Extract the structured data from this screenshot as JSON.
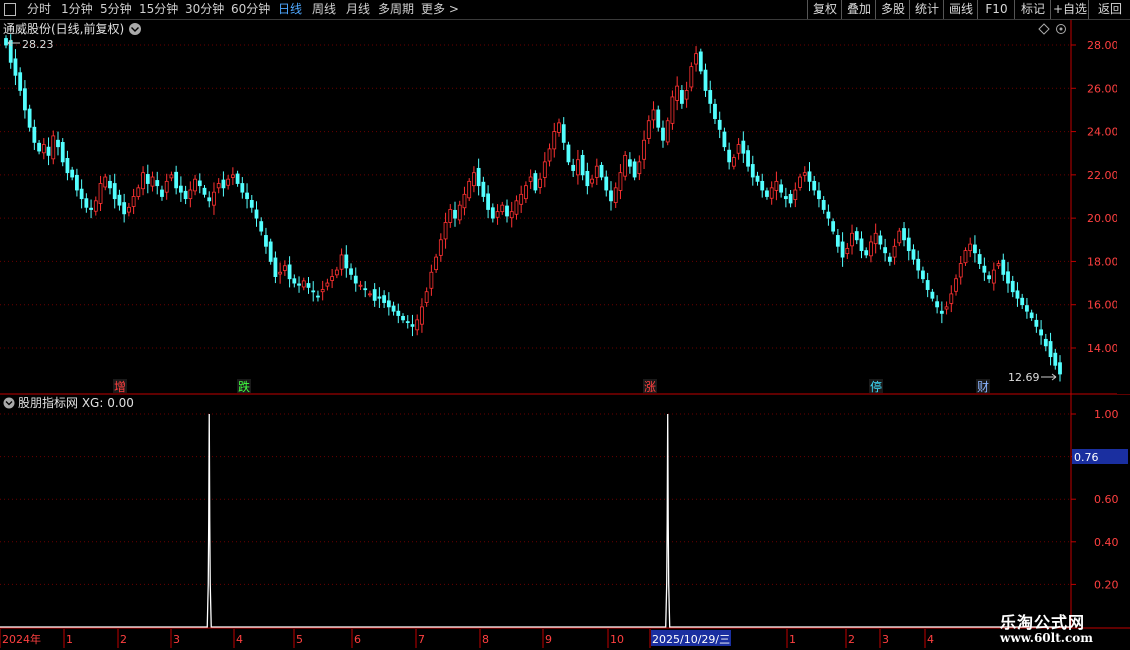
{
  "toolbar": {
    "periods": [
      "分时",
      "1分钟",
      "5分钟",
      "15分钟",
      "30分钟",
      "60分钟",
      "日线",
      "周线",
      "月线",
      "多周期",
      "更多 >"
    ],
    "active_period": "日线",
    "right_buttons": [
      "复权",
      "叠加",
      "多股",
      "统计",
      "画线",
      "F10",
      "标记",
      "+自选",
      "返回"
    ]
  },
  "main_chart": {
    "title": "通威股份(日线,前复权)",
    "high_label": "28.23",
    "low_label": "12.69",
    "y_ticks": [
      "28.00",
      "26.00",
      "24.00",
      "22.00",
      "20.00",
      "18.00",
      "16.00",
      "14.00"
    ],
    "markers": [
      {
        "text": "增",
        "color": "#ff4040"
      },
      {
        "text": "跌",
        "color": "#40ff40"
      },
      {
        "text": "涨",
        "color": "#ff4040"
      },
      {
        "text": "停",
        "color": "#40e0ff"
      },
      {
        "text": "财",
        "color": "#8ab4ff"
      }
    ]
  },
  "indicator": {
    "label": "股朋指标网 XG: 0.00",
    "y_ticks": [
      "1.00",
      "0.80",
      "0.60",
      "0.40",
      "0.20"
    ],
    "highlight_value": "0.76"
  },
  "date_axis": {
    "labels": [
      "2024年",
      "1",
      "2",
      "3",
      "4",
      "5",
      "6",
      "7",
      "8",
      "9",
      "10",
      "2025/10/29/三",
      "1",
      "2",
      "3",
      "4"
    ]
  },
  "watermark": {
    "text": "乐淘公式网",
    "url": "www.60lt.com"
  },
  "colors": {
    "up": "#ff3232",
    "down": "#54ffff",
    "grid": "#7a0000",
    "axis": "#c00000",
    "signal": "#ffffff"
  },
  "chart_data": {
    "type": "candlestick",
    "price_ylim": [
      12.5,
      28.5
    ],
    "close_series": [
      28.0,
      27.2,
      26.6,
      25.9,
      25.0,
      24.2,
      23.5,
      23.1,
      23.4,
      22.9,
      23.8,
      23.3,
      22.6,
      22.1,
      21.9,
      21.3,
      20.9,
      20.5,
      20.4,
      20.8,
      21.6,
      21.9,
      21.4,
      20.9,
      20.6,
      20.2,
      20.5,
      21.0,
      21.4,
      22.1,
      21.6,
      21.9,
      21.5,
      21.0,
      21.7,
      22.0,
      21.4,
      21.2,
      20.9,
      21.3,
      21.8,
      21.5,
      21.1,
      20.8,
      21.2,
      21.6,
      21.4,
      21.8,
      22.0,
      21.6,
      21.2,
      20.9,
      20.5,
      20.0,
      19.4,
      18.7,
      18.0,
      17.3,
      17.5,
      17.8,
      17.2,
      17.0,
      16.9,
      17.1,
      16.8,
      16.6,
      16.4,
      16.7,
      17.0,
      17.3,
      17.6,
      18.3,
      17.7,
      17.4,
      17.0,
      16.9,
      16.7,
      16.5,
      16.2,
      16.3,
      16.1,
      15.9,
      15.7,
      15.5,
      15.3,
      15.2,
      15.0,
      15.3,
      15.9,
      16.6,
      17.5,
      18.2,
      19.0,
      19.8,
      20.4,
      20.0,
      20.6,
      21.1,
      21.7,
      22.1,
      21.5,
      21.0,
      20.4,
      20.0,
      20.3,
      20.6,
      20.1,
      20.3,
      20.8,
      21.1,
      21.5,
      21.9,
      21.3,
      21.8,
      22.6,
      23.2,
      24.0,
      24.4,
      23.5,
      22.6,
      22.2,
      22.7,
      22.0,
      21.5,
      21.8,
      22.4,
      21.9,
      21.3,
      20.8,
      21.4,
      22.1,
      22.9,
      22.4,
      21.9,
      22.6,
      23.6,
      24.5,
      25.0,
      24.2,
      23.6,
      24.5,
      25.6,
      26.1,
      25.3,
      25.9,
      27.0,
      27.6,
      26.8,
      25.9,
      25.3,
      24.6,
      24.1,
      23.3,
      22.6,
      22.8,
      23.4,
      23.0,
      22.4,
      21.9,
      21.7,
      21.3,
      21.0,
      21.4,
      21.7,
      21.2,
      20.9,
      20.7,
      21.3,
      21.9,
      22.1,
      21.7,
      21.3,
      20.9,
      20.4,
      20.0,
      19.4,
      18.7,
      18.2,
      18.6,
      19.3,
      19.0,
      18.5,
      18.3,
      18.9,
      19.3,
      18.8,
      18.4,
      18.0,
      18.7,
      19.4,
      19.0,
      18.5,
      18.1,
      17.6,
      17.2,
      16.7,
      16.3,
      15.9,
      15.6,
      15.9,
      16.5,
      17.2,
      17.9,
      18.5,
      18.8,
      18.4,
      17.9,
      17.5,
      17.2,
      17.6,
      17.9,
      17.4,
      17.0,
      16.6,
      16.3,
      16.0,
      15.7,
      15.4,
      15.0,
      14.6,
      14.1,
      13.6,
      13.2,
      12.8
    ],
    "indicator_series": {
      "name": "XG",
      "signals": [
        {
          "date_index": 43,
          "value": 1.0
        },
        {
          "date_index": 140,
          "value": 1.0
        }
      ],
      "ylim": [
        0,
        1.1
      ]
    }
  }
}
